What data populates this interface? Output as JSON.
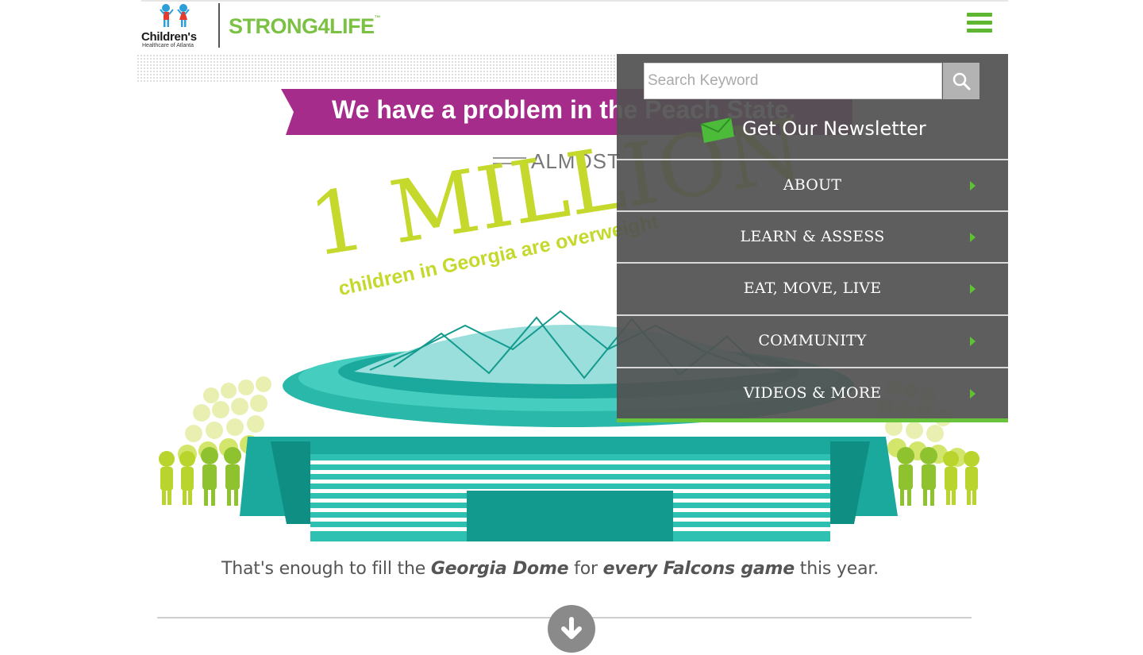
{
  "header": {
    "childrens_name": "Children's",
    "childrens_sub": "Healthcare of Atlanta",
    "strong4life_brand": "STRONG4LIFE",
    "menu_icon": "hamburger-menu-icon"
  },
  "hero": {
    "banner_text": "We have a problem in the Peach State.",
    "almost": "ALMOST",
    "big_number": "1 MILLION",
    "sub_text": "children in Georgia are overweight",
    "caption_pre": "That's enough to fill the ",
    "caption_bold1": "Georgia Dome",
    "caption_mid": " for ",
    "caption_bold2": "every Falcons game",
    "caption_post": " this year."
  },
  "menu": {
    "search_placeholder": "Search Keyword",
    "search_value": "",
    "newsletter_label": "Get Our Newsletter",
    "items": [
      {
        "label": "ABOUT"
      },
      {
        "label": "LEARN & ASSESS"
      },
      {
        "label": "EAT, MOVE, LIVE"
      },
      {
        "label": "COMMUNITY"
      },
      {
        "label": "VIDEOS & MORE"
      }
    ]
  },
  "colors": {
    "brand_green": "#7bc144",
    "menu_accent": "#5fc232",
    "banner_purple": "#a52c8a",
    "lime": "#c5d92d",
    "teal": "#2ab9ab"
  }
}
